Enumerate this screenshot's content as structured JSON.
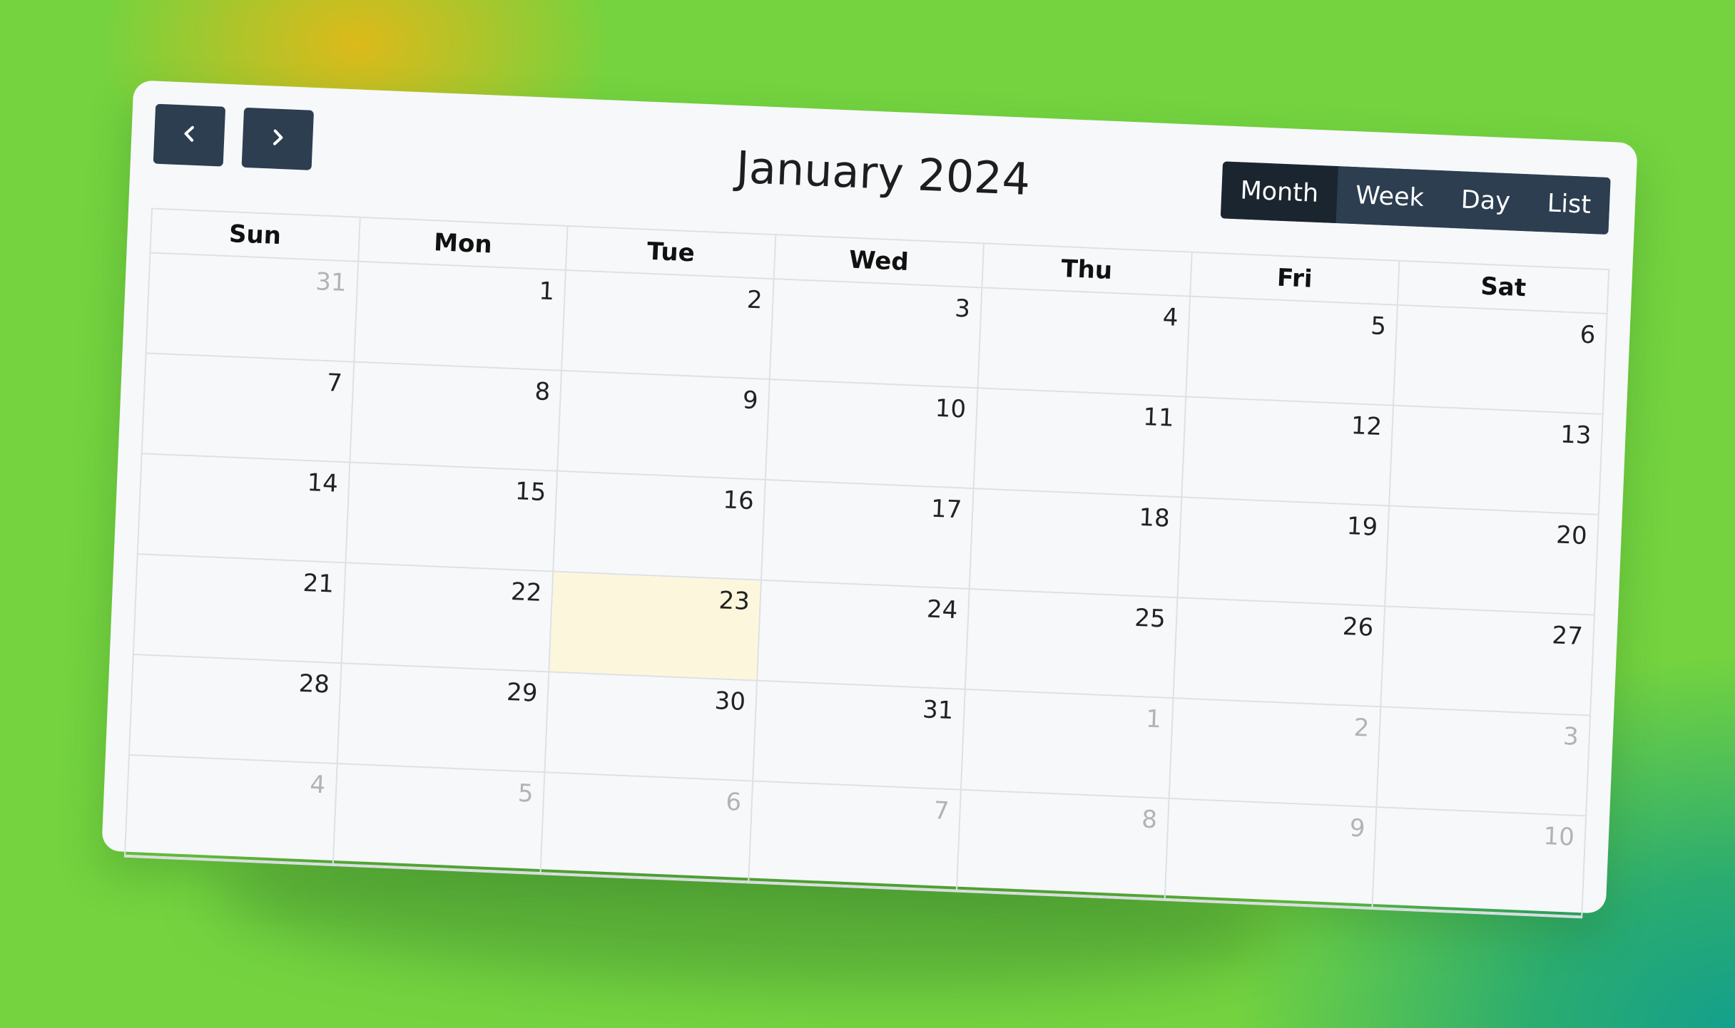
{
  "calendar": {
    "title": "January 2024",
    "views": [
      "Month",
      "Week",
      "Day",
      "List"
    ],
    "active_view": "Month",
    "weekdays": [
      "Sun",
      "Mon",
      "Tue",
      "Wed",
      "Thu",
      "Fri",
      "Sat"
    ],
    "days": [
      {
        "n": "31",
        "other": true
      },
      {
        "n": "1"
      },
      {
        "n": "2"
      },
      {
        "n": "3"
      },
      {
        "n": "4"
      },
      {
        "n": "5"
      },
      {
        "n": "6"
      },
      {
        "n": "7"
      },
      {
        "n": "8"
      },
      {
        "n": "9"
      },
      {
        "n": "10"
      },
      {
        "n": "11"
      },
      {
        "n": "12"
      },
      {
        "n": "13"
      },
      {
        "n": "14"
      },
      {
        "n": "15"
      },
      {
        "n": "16"
      },
      {
        "n": "17"
      },
      {
        "n": "18"
      },
      {
        "n": "19"
      },
      {
        "n": "20"
      },
      {
        "n": "21"
      },
      {
        "n": "22"
      },
      {
        "n": "23",
        "today": true
      },
      {
        "n": "24"
      },
      {
        "n": "25"
      },
      {
        "n": "26"
      },
      {
        "n": "27"
      },
      {
        "n": "28"
      },
      {
        "n": "29"
      },
      {
        "n": "30"
      },
      {
        "n": "31"
      },
      {
        "n": "1",
        "other": true
      },
      {
        "n": "2",
        "other": true
      },
      {
        "n": "3",
        "other": true
      },
      {
        "n": "4",
        "other": true
      },
      {
        "n": "5",
        "other": true
      },
      {
        "n": "6",
        "other": true
      },
      {
        "n": "7",
        "other": true
      },
      {
        "n": "8",
        "other": true
      },
      {
        "n": "9",
        "other": true
      },
      {
        "n": "10",
        "other": true
      }
    ]
  },
  "icons": {
    "prev": "chevron-left-icon",
    "next": "chevron-right-icon"
  },
  "colors": {
    "button": "#2c3e50",
    "button_active": "#1a252f",
    "today": "#fcf7dc",
    "background": "#74d33f"
  }
}
